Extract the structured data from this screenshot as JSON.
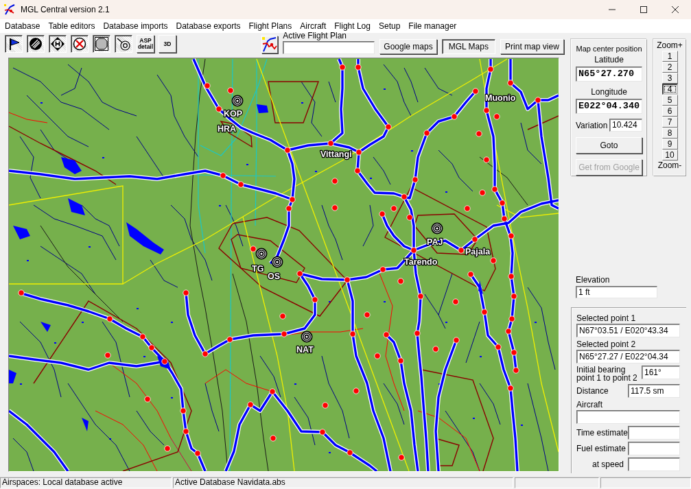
{
  "window": {
    "title": "MGL Central version 2.1"
  },
  "menu": [
    "Database",
    "Table editors",
    "Database imports",
    "Database exports",
    "Flight Plans",
    "Aircraft",
    "Flight Log",
    "Setup",
    "File manager"
  ],
  "toolbar": {
    "buttons": [
      {
        "kind": "icon",
        "on": true
      },
      {
        "kind": "icon",
        "on": true
      },
      {
        "kind": "icon",
        "on": true
      },
      {
        "kind": "icon",
        "on": true
      },
      {
        "kind": "icon",
        "on": true
      },
      {
        "kind": "icon",
        "on": true
      },
      {
        "kind": "text",
        "label": "ASP detail",
        "on": false
      },
      {
        "kind": "text",
        "label": "3D",
        "on": false
      }
    ],
    "flight_plan_label": "Active Flight Plan",
    "map_sources": [
      {
        "label": "Google maps",
        "selected": false
      },
      {
        "label": "MGL Maps",
        "selected": true
      }
    ],
    "print_button": "Print map view"
  },
  "map": {
    "labels": [
      "KOP",
      "HRA",
      "Vittangi",
      "Muonio",
      "PAJ",
      "Tarendo",
      "Pajala",
      "TG",
      "OS",
      "NAT"
    ]
  },
  "center_position": {
    "title": "Map center position",
    "latitude_label": "Latitude",
    "latitude": "N65°27.270",
    "longitude_label": "Longitude",
    "longitude": "E022°04.340",
    "variation_label": "Variation",
    "variation": "10.424",
    "goto_button": "Goto",
    "google_button": {
      "label": "Get from Google",
      "disabled": true
    }
  },
  "zoom": {
    "plus_label": "Zoom+",
    "levels": [
      {
        "label": "1",
        "selected": false
      },
      {
        "label": "2",
        "selected": false
      },
      {
        "label": "3",
        "selected": false
      },
      {
        "label": "4",
        "selected": true
      },
      {
        "label": "5",
        "selected": false
      },
      {
        "label": "6",
        "selected": false
      },
      {
        "label": "7",
        "selected": false
      },
      {
        "label": "8",
        "selected": false
      },
      {
        "label": "9",
        "selected": false
      },
      {
        "label": "10",
        "selected": false
      }
    ],
    "minus_label": "Zoom-"
  },
  "elevation": {
    "label": "Elevation",
    "value": "1 ft"
  },
  "route": {
    "fields": [
      {
        "kind": "stacked",
        "label": "Selected point 1",
        "value": "N67°03.51 / E020°43.34"
      },
      {
        "kind": "stacked",
        "label": "Selected point 2",
        "value": "N65°27.27 / E022°04.34"
      },
      {
        "kind": "inline_wrapped",
        "label": "Initial bearing point 1 to point 2",
        "value": "161°"
      },
      {
        "kind": "inline",
        "label": "Distance",
        "value": "117.5 sm"
      },
      {
        "kind": "stacked",
        "label": "Aircraft"
      },
      {
        "kind": "inline",
        "label": "Time estimate"
      },
      {
        "kind": "inline",
        "label": "Fuel estimate"
      },
      {
        "kind": "inline_right",
        "label": "at speed"
      }
    ]
  },
  "status_bar": [
    "Airspaces: Local database active",
    "Active Database Navidata.abs"
  ]
}
